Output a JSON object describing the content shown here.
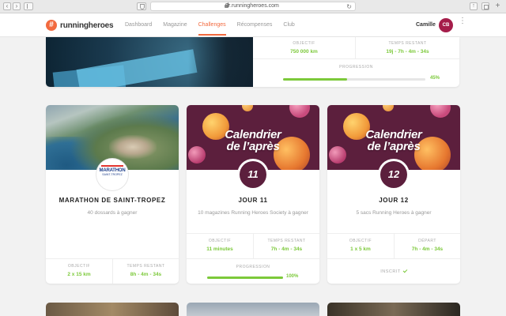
{
  "browser": {
    "url": "fr.runningheroes.com",
    "back": "‹",
    "forward": "›",
    "reload": "↻",
    "share": "↑",
    "add_tab": "+"
  },
  "header": {
    "logo_glyph": "#",
    "logo_text": "runningheroes",
    "nav": [
      {
        "label": "Dashboard",
        "active": false
      },
      {
        "label": "Magazine",
        "active": false
      },
      {
        "label": "Challenges",
        "active": true
      },
      {
        "label": "Récompenses",
        "active": false
      },
      {
        "label": "Club",
        "active": false
      }
    ],
    "user_name": "Camille",
    "avatar_initials": "CB",
    "menu_glyph": "⋮"
  },
  "top_card": {
    "objective_label": "OBJECTIF",
    "objective_value": "750 000 km",
    "time_label": "TEMPS RESTANT",
    "time_value": "19j - 7h - 4m - 34s",
    "progress_label": "PROGRESSION",
    "progress_pct": 45,
    "progress_text": "45%"
  },
  "cards": [
    {
      "title": "MARATHON DE SAINT-TROPEZ",
      "subtitle": "40 dossards à gagner",
      "badge_logo": {
        "line1": "MARATHON",
        "line2": "SAINT-TROPEZ"
      },
      "stats": [
        {
          "label": "OBJECTIF",
          "value": "2 x 15 km"
        },
        {
          "label": "TEMPS RESTANT",
          "value": "8h - 4m - 34s"
        }
      ]
    },
    {
      "title": "JOUR 11",
      "subtitle": "10 magazines Running Heroes Society à gagner",
      "image_title": [
        "Calendrier",
        "de l’après"
      ],
      "badge_number": "11",
      "stats": [
        {
          "label": "OBJECTIF",
          "value": "11 minutes"
        },
        {
          "label": "TEMPS RESTANT",
          "value": "7h - 4m - 34s"
        }
      ],
      "progress_label": "PROGRESSION",
      "progress_pct": 100,
      "progress_text": "100%"
    },
    {
      "title": "JOUR 12",
      "subtitle": "5 sacs Running Heroes à gagner",
      "image_title": [
        "Calendrier",
        "de l’après"
      ],
      "badge_number": "12",
      "stats": [
        {
          "label": "OBJECTIF",
          "value": "1 x 5 km"
        },
        {
          "label": "DÉPART",
          "value": "7h - 4m - 34s"
        }
      ],
      "status": "INSCRIT"
    }
  ],
  "colors": {
    "brand": "#f26a3f",
    "green": "#7cc93a",
    "calendar_purple": "#5c1f3d",
    "avatar": "#a51d4a"
  }
}
